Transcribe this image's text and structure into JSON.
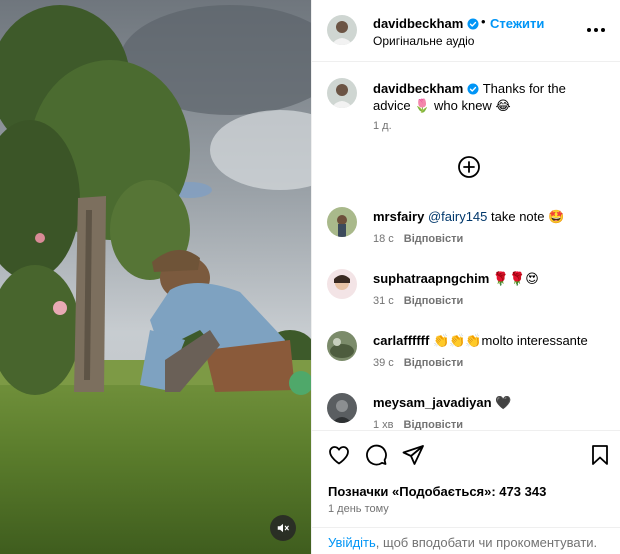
{
  "header": {
    "username": "davidbeckham",
    "separator": "•",
    "follow_label": "Стежити",
    "audio_label": "Оригінальне аудіо"
  },
  "caption": {
    "username": "davidbeckham",
    "text_before": "Thanks for the advice",
    "emoji_1": "🌷",
    "text_mid": "who knew",
    "emoji_2": "😂",
    "time": "1 д."
  },
  "comments": [
    {
      "username": "mrsfairy",
      "mention": "@fairy145",
      "text": "take note 🤩",
      "time": "18 с",
      "reply": "Відповісти"
    },
    {
      "username": "suphatraapngchim",
      "mention": "",
      "text": "🌹🌹😍",
      "time": "31 с",
      "reply": "Відповісти"
    },
    {
      "username": "carlaffffff",
      "mention": "",
      "text": "👏👏👏molto interessante",
      "time": "39 с",
      "reply": "Відповісти"
    },
    {
      "username": "meysam_javadiyan",
      "mention": "",
      "text": "🖤",
      "time": "1 хв",
      "reply": "Відповісти"
    }
  ],
  "footer": {
    "likes_label": "Позначки «Подобається»: 473 343",
    "posted_time": "1 день тому",
    "login_link": "Увійдіть",
    "login_rest": ", щоб вподобати чи прокоментувати."
  },
  "icons": {
    "verified": "verified-badge-icon",
    "more": "more-options-icon",
    "load_more": "load-more-comments-icon",
    "like": "heart-icon",
    "comment": "comment-icon",
    "share": "share-icon",
    "save": "bookmark-icon",
    "mute": "sound-off-icon"
  },
  "colors": {
    "accent": "#0095f6",
    "secondary_text": "#737373",
    "border": "#efefef"
  }
}
